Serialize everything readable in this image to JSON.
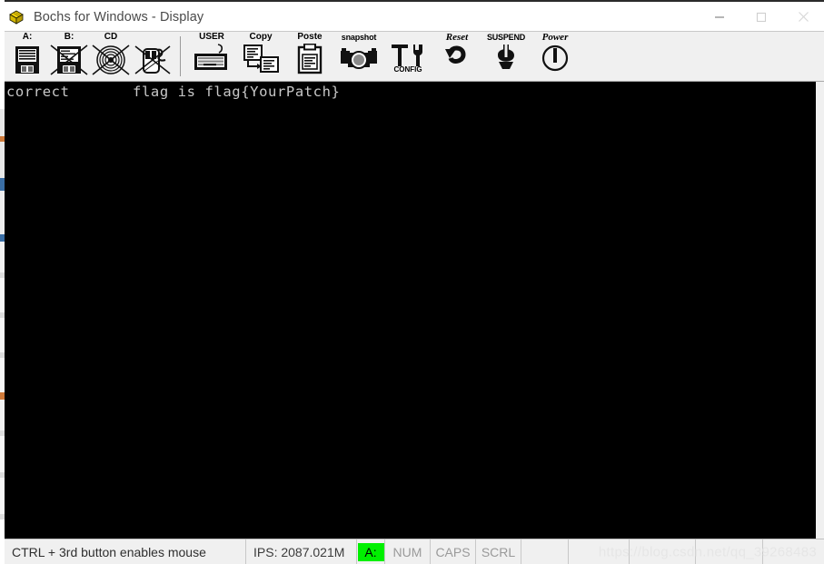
{
  "window": {
    "title": "Bochs for Windows - Display",
    "icon_name": "bochs-logo-icon",
    "controls": {
      "minimize": "—",
      "maximize": "□",
      "close": "✕"
    }
  },
  "toolbar": {
    "items": [
      {
        "name": "floppy-a-button",
        "label": "A:",
        "icon": "floppy-disk-icon",
        "disabled": false
      },
      {
        "name": "floppy-b-button",
        "label": "B:",
        "icon": "floppy-disk-icon",
        "disabled": true
      },
      {
        "name": "cdrom-button",
        "label": "CD",
        "icon": "cdrom-disc-icon",
        "disabled": true
      },
      {
        "name": "mouse-button",
        "label": "",
        "icon": "mouse-icon",
        "disabled": true
      },
      {
        "name": "user-button",
        "label": "USER",
        "icon": "keyboard-icon",
        "disabled": false
      },
      {
        "name": "copy-button",
        "label": "Copy",
        "icon": "copy-icon",
        "disabled": false
      },
      {
        "name": "paste-button",
        "label": "Poste",
        "icon": "clipboard-paste-icon",
        "disabled": false
      },
      {
        "name": "snapshot-button",
        "label": "snapshot",
        "icon": "camera-icon",
        "disabled": false
      },
      {
        "name": "config-button",
        "label": "",
        "sublabel": "CONFIG",
        "icon": "tools-icon",
        "disabled": false
      },
      {
        "name": "reset-button",
        "label": "Reset",
        "icon": "reset-arrow-icon",
        "disabled": false
      },
      {
        "name": "suspend-button",
        "label": "SUSPEND",
        "icon": "suspend-icon",
        "disabled": false
      },
      {
        "name": "power-button",
        "label": "Power",
        "icon": "power-icon",
        "disabled": false
      }
    ]
  },
  "display": {
    "line": "correct       flag is flag{YourPatch}",
    "background_color": "#000000",
    "text_color": "#c8c8c8"
  },
  "statusbar": {
    "message": "CTRL + 3rd button enables mouse",
    "ips": "IPS: 2087.021M",
    "floppy_led": "A:",
    "floppy_led_color": "#00f000",
    "num": "NUM",
    "caps": "CAPS",
    "scrl": "SCRL"
  },
  "watermark": "https://blog.csdn.net/qq_39268483"
}
